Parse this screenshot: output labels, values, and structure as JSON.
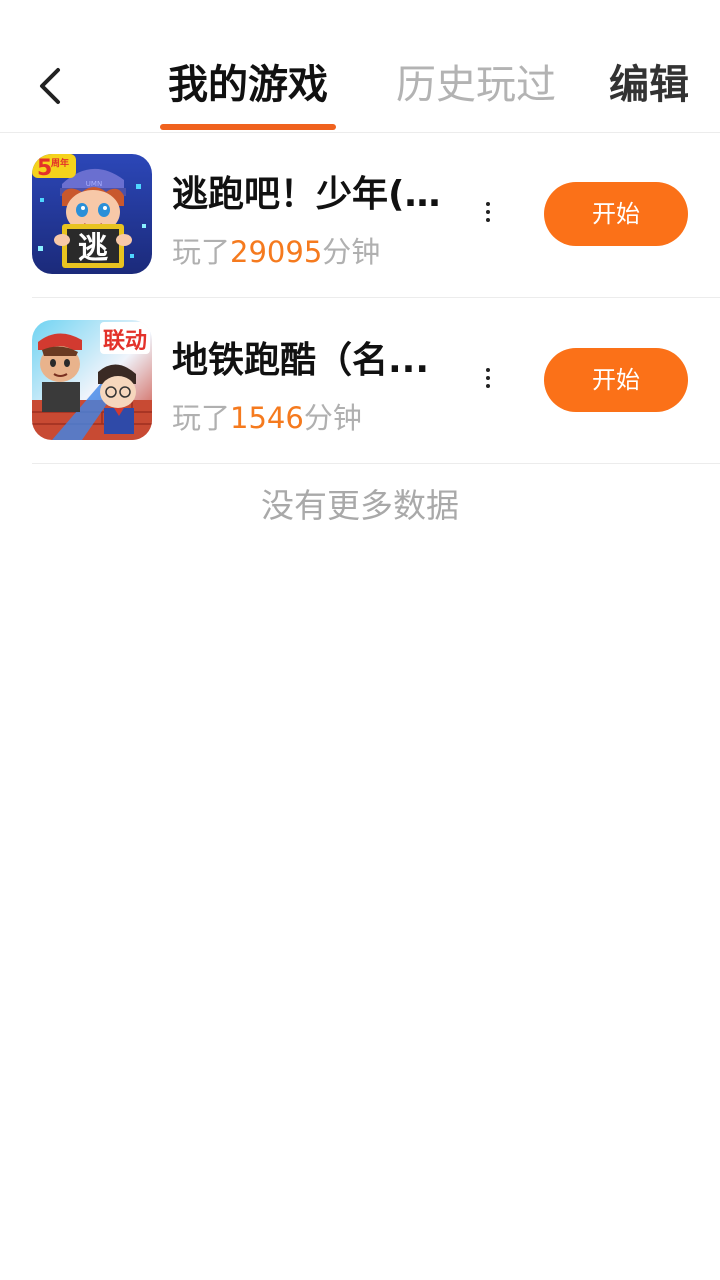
{
  "header": {
    "back_icon": "chevron-left-icon",
    "tabs": [
      {
        "label": "我的游戏",
        "active": true
      },
      {
        "label": "历史玩过",
        "active": false
      }
    ],
    "edit_label": "编辑",
    "accent_color": "#f0621e"
  },
  "games": [
    {
      "name": "逃跑吧！少年(...",
      "played_prefix": "玩了",
      "minutes": "29095",
      "played_suffix": "分钟",
      "start_label": "开始",
      "icon_badge": "5",
      "icon_badge_small": "周年",
      "icon_glyph": "逃",
      "icon_caption": "UMN"
    },
    {
      "name": "地铁跑酷（名...",
      "played_prefix": "玩了",
      "minutes": "1546",
      "played_suffix": "分钟",
      "start_label": "开始",
      "icon_badge": "联动"
    }
  ],
  "footer": {
    "no_more_text": "没有更多数据"
  },
  "colors": {
    "start_button": "#fb7118",
    "minutes_highlight": "#f57a1e",
    "inactive_tab": "#b3b3b3"
  }
}
